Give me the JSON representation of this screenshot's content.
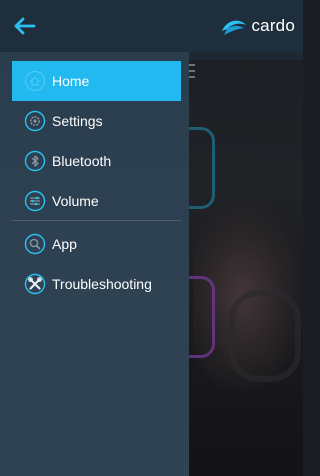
{
  "header": {
    "brand_name": "cardo",
    "back_icon": "arrow-left-icon",
    "brand_icon": "cardo-logo-icon"
  },
  "colors": {
    "header_bg": "#1f2e3c",
    "drawer_bg": "#2d4152",
    "accent": "#21b9f0",
    "icon_cyan": "#2bc0f0",
    "text": "#ffffff"
  },
  "menu": {
    "items": [
      {
        "label": "Home",
        "icon": "home-icon",
        "active": true
      },
      {
        "label": "Settings",
        "icon": "settings-icon",
        "active": false
      },
      {
        "label": "Bluetooth",
        "icon": "bluetooth-icon",
        "active": false
      },
      {
        "label": "Volume",
        "icon": "volume-icon",
        "active": false
      },
      {
        "label": "App",
        "icon": "app-icon",
        "active": false
      },
      {
        "label": "Troubleshooting",
        "icon": "troubleshooting-icon",
        "active": false
      }
    ]
  }
}
